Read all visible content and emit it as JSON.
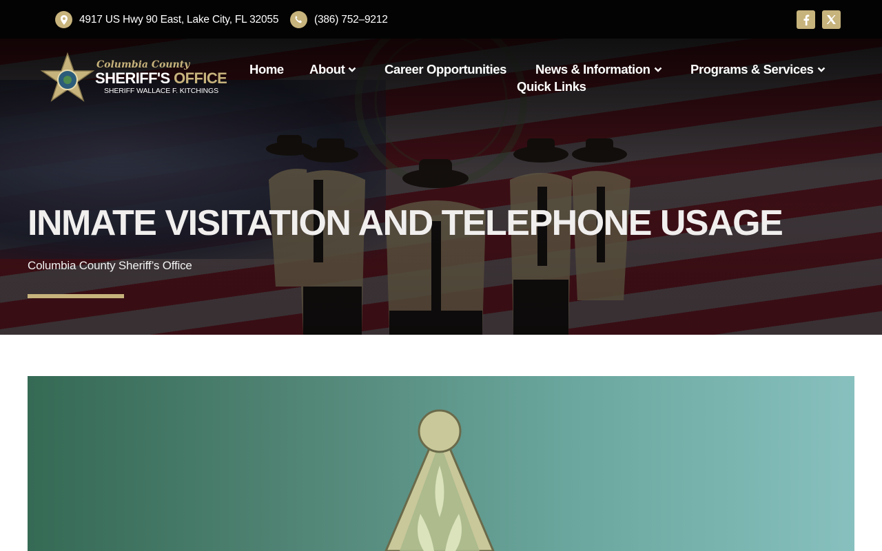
{
  "topbar": {
    "address": "4917 US Hwy 90 East, Lake City, FL 32055",
    "phone": "(386) 752–9212",
    "address_icon": "map-pin-icon",
    "phone_icon": "phone-icon",
    "social": [
      {
        "name": "facebook",
        "icon": "facebook-icon"
      },
      {
        "name": "x",
        "icon": "x-twitter-icon"
      }
    ]
  },
  "logo": {
    "line1": "Columbia County",
    "line2a": "SHERIFF'S",
    "line2b": "OFFICE",
    "line3": "SHERIFF WALLACE F. KITCHINGS"
  },
  "nav": {
    "items": [
      {
        "label": "Home",
        "has_dropdown": false
      },
      {
        "label": "About",
        "has_dropdown": true
      },
      {
        "label": "Career Opportunities",
        "has_dropdown": false
      },
      {
        "label": "News & Information",
        "has_dropdown": true
      },
      {
        "label": "Programs & Services",
        "has_dropdown": true
      },
      {
        "label": "Quick Links",
        "has_dropdown": false
      }
    ]
  },
  "hero": {
    "title": "INMATE VISITATION AND TELEPHONE USAGE",
    "subtitle": "Columbia County Sheriff’s Office"
  },
  "colors": {
    "accent_gold": "#c7b37c",
    "topbar_bg": "#030303",
    "feature_gradient_start": "#356a55",
    "feature_gradient_end": "#87c0be"
  }
}
